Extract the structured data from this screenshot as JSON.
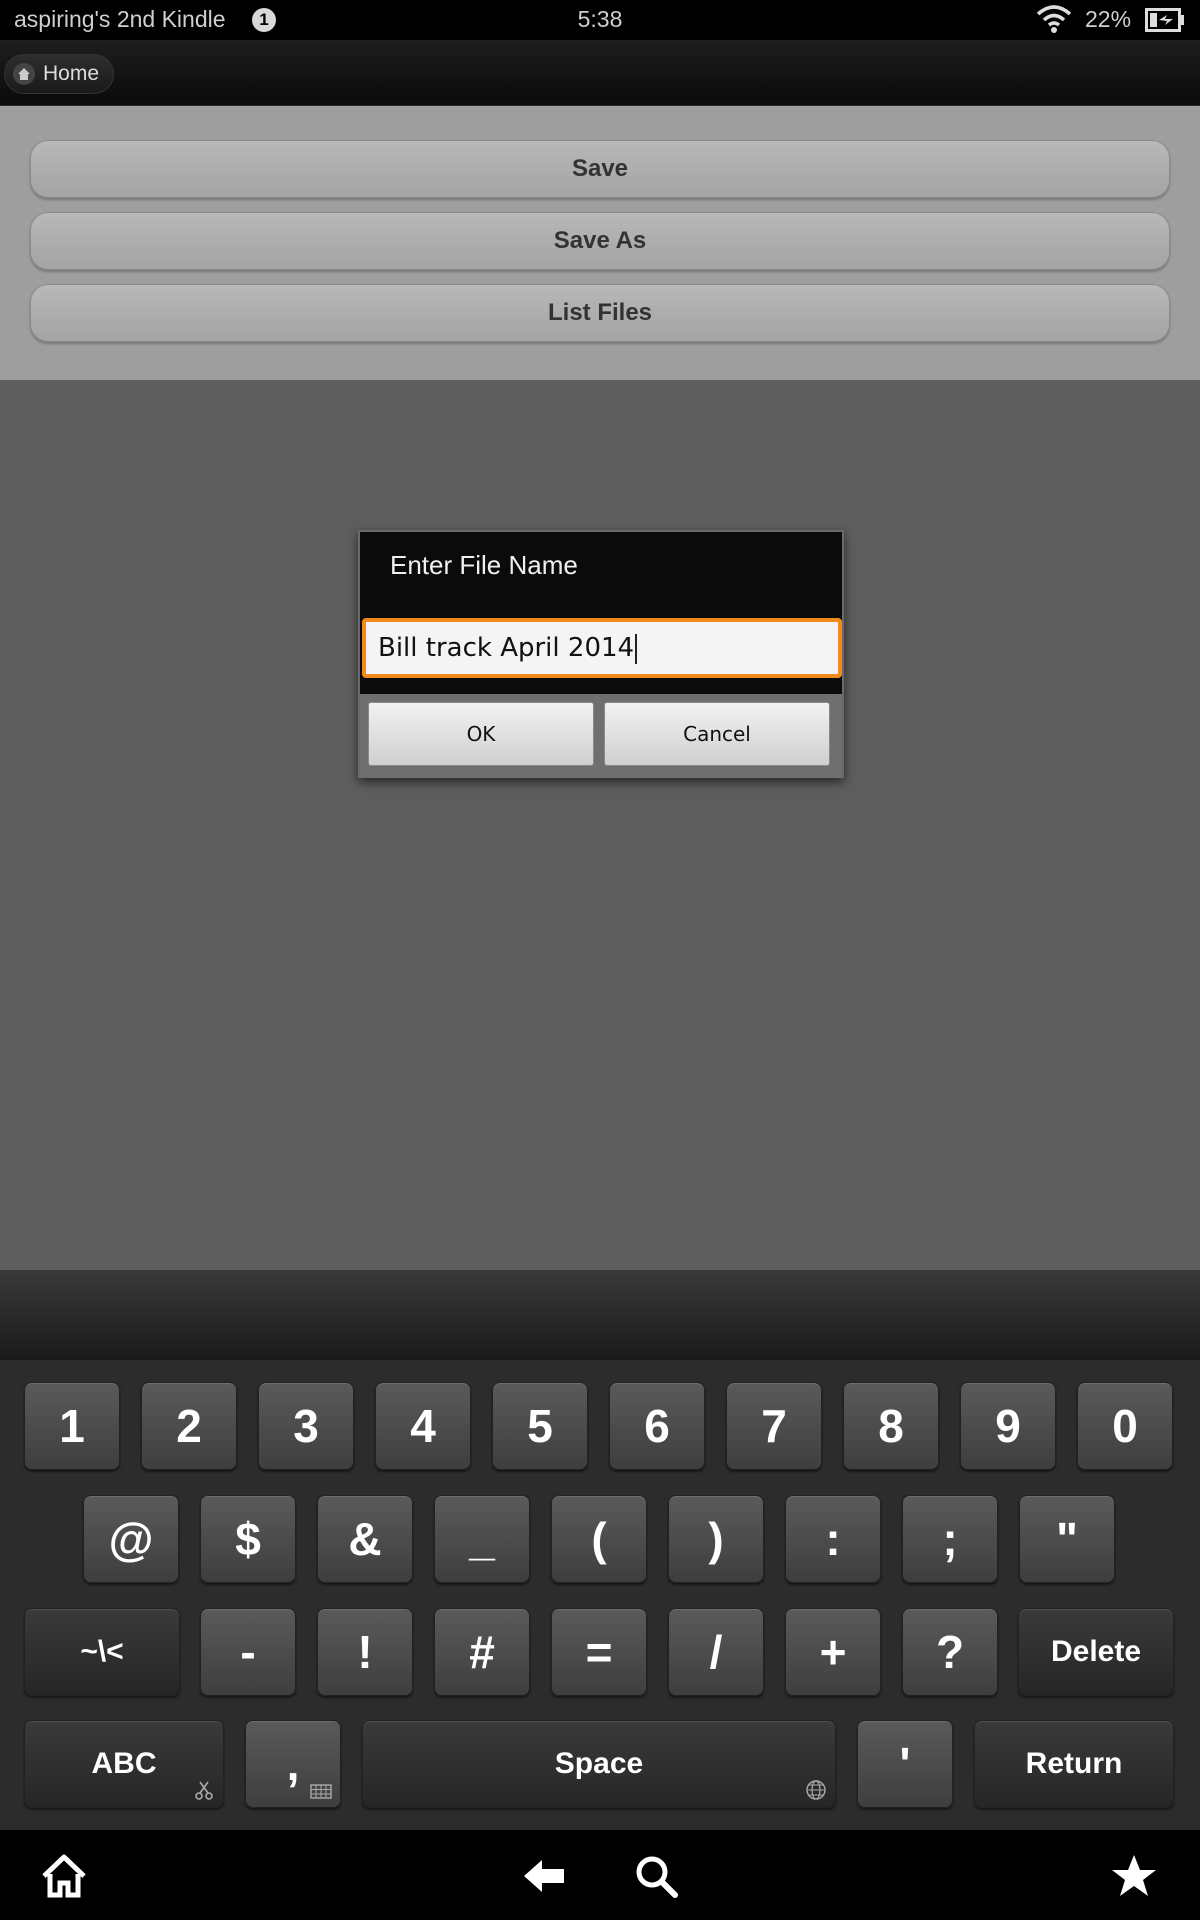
{
  "status_bar": {
    "device_name": "aspiring's 2nd Kindle",
    "notification_count": "1",
    "time": "5:38",
    "battery_percent": "22%"
  },
  "action_bar": {
    "home_label": "Home"
  },
  "menu": {
    "save_label": "Save",
    "save_as_label": "Save As",
    "list_files_label": "List Files"
  },
  "dialog": {
    "title": "Enter File Name",
    "input_value": "Bill track April 2014",
    "ok_label": "OK",
    "cancel_label": "Cancel",
    "input_focus_color": "#f08a1c"
  },
  "keyboard": {
    "row1": [
      "1",
      "2",
      "3",
      "4",
      "5",
      "6",
      "7",
      "8",
      "9",
      "0"
    ],
    "row2": [
      "@",
      "$",
      "&",
      "_",
      "(",
      ")",
      ":",
      ";",
      "\""
    ],
    "row3": [
      "~\\<",
      "-",
      "!",
      "#",
      "=",
      "/",
      "+",
      "?",
      "Delete"
    ],
    "row4": [
      "ABC",
      ",",
      "Space",
      "'",
      "Return"
    ]
  },
  "nav_icons": [
    "home-icon",
    "back-icon",
    "search-icon",
    "favorites-star-icon"
  ]
}
